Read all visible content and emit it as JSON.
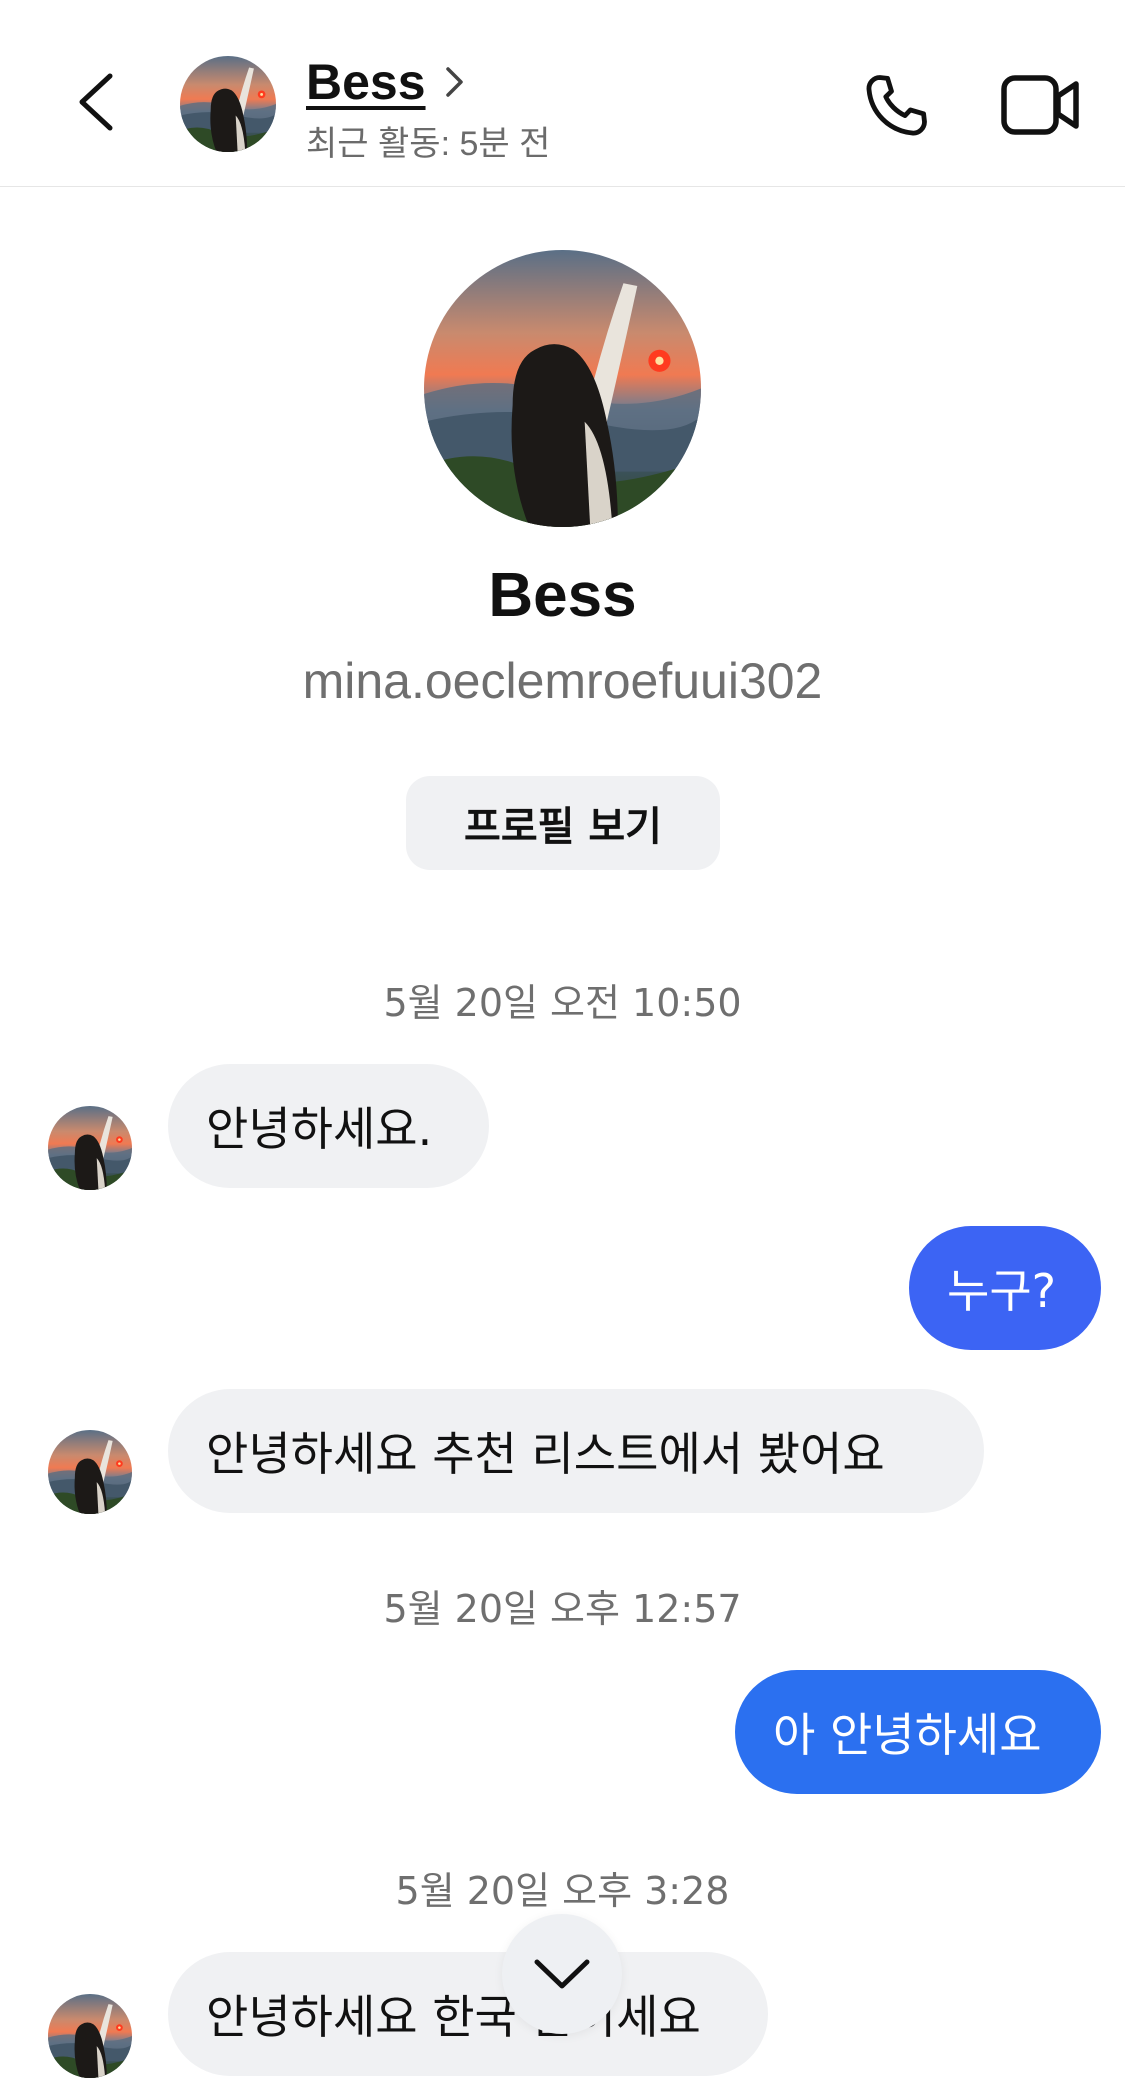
{
  "header": {
    "name": "Bess",
    "status": "최근 활동: 5분 전"
  },
  "profile": {
    "name": "Bess",
    "username": "mina.oeclemroefuui302",
    "view_profile_label": "프로필 보기"
  },
  "messages": [
    {
      "type": "timestamp",
      "text": "5월 20일 오전 10:50"
    },
    {
      "type": "incoming",
      "text": "안녕하세요."
    },
    {
      "type": "outgoing",
      "text": "누구?",
      "color": "#3c64f4"
    },
    {
      "type": "incoming",
      "text": "안녕하세요 추천 리스트에서 봤어요"
    },
    {
      "type": "timestamp",
      "text": "5월 20일 오후 12:57"
    },
    {
      "type": "outgoing",
      "text": "아 안녕하세요",
      "color": "#2b70f0"
    },
    {
      "type": "timestamp",
      "text": "5월 20일 오후 3:28"
    },
    {
      "type": "incoming",
      "text": "안녕하세요 한국 분이세요"
    }
  ],
  "icons": {
    "back": "chevron-left-icon",
    "call": "phone-icon",
    "video": "video-camera-icon",
    "scroll_down": "chevron-down-icon"
  },
  "colors": {
    "outgoing_bubble_1": "#3c64f4",
    "outgoing_bubble_2": "#2b70f0",
    "incoming_bubble": "#f0f1f3"
  }
}
